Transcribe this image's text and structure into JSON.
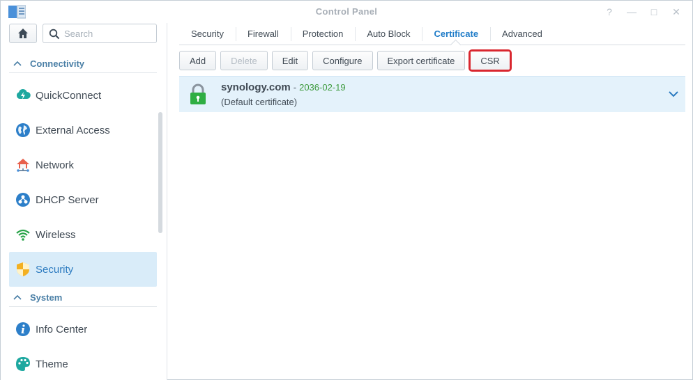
{
  "window": {
    "title": "Control Panel",
    "controls": [
      "?",
      "—",
      "□",
      "✕"
    ]
  },
  "sidebar": {
    "search": {
      "placeholder": "Search",
      "value": ""
    },
    "sections": [
      {
        "label": "Connectivity"
      },
      {
        "label": "System"
      }
    ],
    "items": [
      {
        "label": "QuickConnect",
        "icon": "quickconnect-icon"
      },
      {
        "label": "External Access",
        "icon": "globe-icon"
      },
      {
        "label": "Network",
        "icon": "network-icon"
      },
      {
        "label": "DHCP Server",
        "icon": "dhcp-server-icon"
      },
      {
        "label": "Wireless",
        "icon": "wifi-icon"
      },
      {
        "label": "Security",
        "icon": "shield-icon",
        "active": true
      },
      {
        "label": "Info Center",
        "icon": "info-icon"
      },
      {
        "label": "Theme",
        "icon": "palette-icon"
      }
    ]
  },
  "tabs": [
    {
      "label": "Security"
    },
    {
      "label": "Firewall"
    },
    {
      "label": "Protection"
    },
    {
      "label": "Auto Block"
    },
    {
      "label": "Certificate",
      "active": true
    },
    {
      "label": "Advanced"
    }
  ],
  "toolbar": {
    "add": "Add",
    "delete": "Delete",
    "edit": "Edit",
    "configure": "Configure",
    "export": "Export certificate",
    "csr": "CSR"
  },
  "certificates": [
    {
      "name": "synology.com",
      "separator": "-",
      "expiry": "2036-02-19",
      "note": "(Default certificate)"
    }
  ],
  "colors": {
    "accent": "#1f7cc8",
    "active_bg": "#d9ecf9",
    "highlight_border": "#d9262e",
    "expiry_green": "#3c9a3c",
    "lock_green": "#2fae43"
  }
}
